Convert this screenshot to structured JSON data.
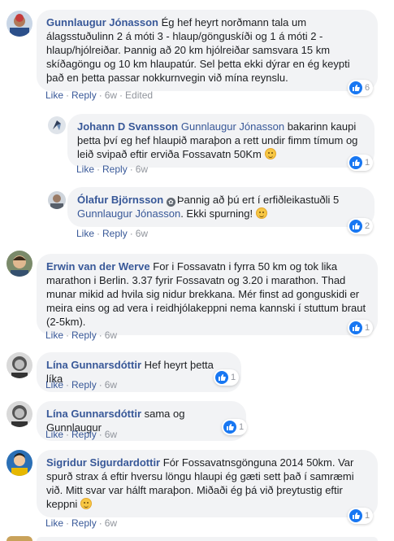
{
  "actions": {
    "like": "Like",
    "reply": "Reply",
    "dot": "·"
  },
  "comments": [
    {
      "author": "Gunnlaugur Jónasson",
      "text": "Ég hef heyrt norðmann tala um álagsstuðulinn 2 á móti 3 - hlaup/gönguskíði og 1 á móti 2 - hlaup/hjólreiðar. Þannig að 20 km hjólreiðar samsvara 15 km skíðagöngu og 10 km hlaupatúr. Sel þetta ekki dýrar en ég keypti það en þetta passar nokkurnvegin við mína reynslu.",
      "time": "6w",
      "edited": "Edited",
      "likes": "6"
    },
    {
      "author": "Johann D Svansson",
      "mention": "Gunnlaugur Jónasson",
      "text": "bakarinn kaupi þetta því eg hef hlaupið maraþon a rett undir fimm tímum og leið svipað eftir erviða Fossavatn 50Km",
      "time": "6w",
      "likes": "1"
    },
    {
      "author": "Ólafur Björnsson",
      "text_before": "Þannig að þú ert í erfiðleikastuðli 5",
      "mention": "Gunnlaugur Jónasson",
      "text_after": ". Ekki spurning!",
      "time": "6w",
      "likes": "2"
    },
    {
      "author": "Erwin van der Werve",
      "text": "For i Fossavatn i fyrra 50 km og tok lika marathon i Berlin. 3.37 fyrir Fossavatn og 3.20 i marathon. Thad munar mikid ad hvila sig nidur brekkana. Mér finst ad gonguskidi er meira eins og ad vera i reidhjólakeppni nema kannski í stuttum braut (2-5km).",
      "time": "6w",
      "likes": "1"
    },
    {
      "author": "Lína Gunnarsdóttir",
      "text": "Hef heyrt þetta líka",
      "time": "6w",
      "likes": "1"
    },
    {
      "author": "Lína Gunnarsdóttir",
      "text": "sama og Gunnlaugur",
      "time": "6w",
      "likes": "1"
    },
    {
      "author": "Sigridur Sigurdardottir",
      "text": "Fór Fossavatnsgönguna 2014 50km. Var spurð strax á eftir hversu löngu hlaupi ég gæti sett það í samræmi við. Mitt svar var hálft maraþon. Miðaði ég þá við þreytustig eftir keppni",
      "time": "6w",
      "likes": "1"
    }
  ],
  "colors": {
    "link": "#385898",
    "bubble": "#f2f3f5",
    "like_blue": "#1877f2",
    "meta": "#90949c"
  }
}
